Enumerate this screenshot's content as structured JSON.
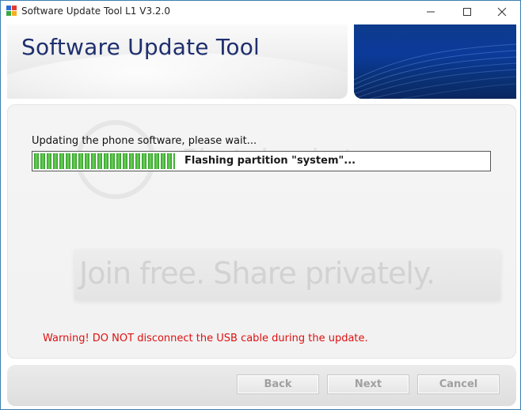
{
  "window": {
    "title": "Software Update Tool L1 V3.2.0",
    "controls": {
      "minimize": "—",
      "maximize": "☐",
      "close": "✕"
    }
  },
  "header": {
    "title": "Software Update Tool"
  },
  "main": {
    "status_label": "Updating the phone software, please wait...",
    "progress": {
      "value": 0.31,
      "text": "Flashing partition \"system\"..."
    },
    "watermark": {
      "brand": "Photobucket",
      "tagline": "Join free. Share privately."
    },
    "warning": "Warning! DO NOT disconnect the USB cable during the update."
  },
  "footer": {
    "back_label": "Back",
    "next_label": "Next",
    "cancel_label": "Cancel"
  },
  "colors": {
    "title_blue": "#1f2f6e",
    "warning_red": "#e01010",
    "progress_green": "#2e9a28",
    "disabled_text": "#a0a0a0"
  }
}
